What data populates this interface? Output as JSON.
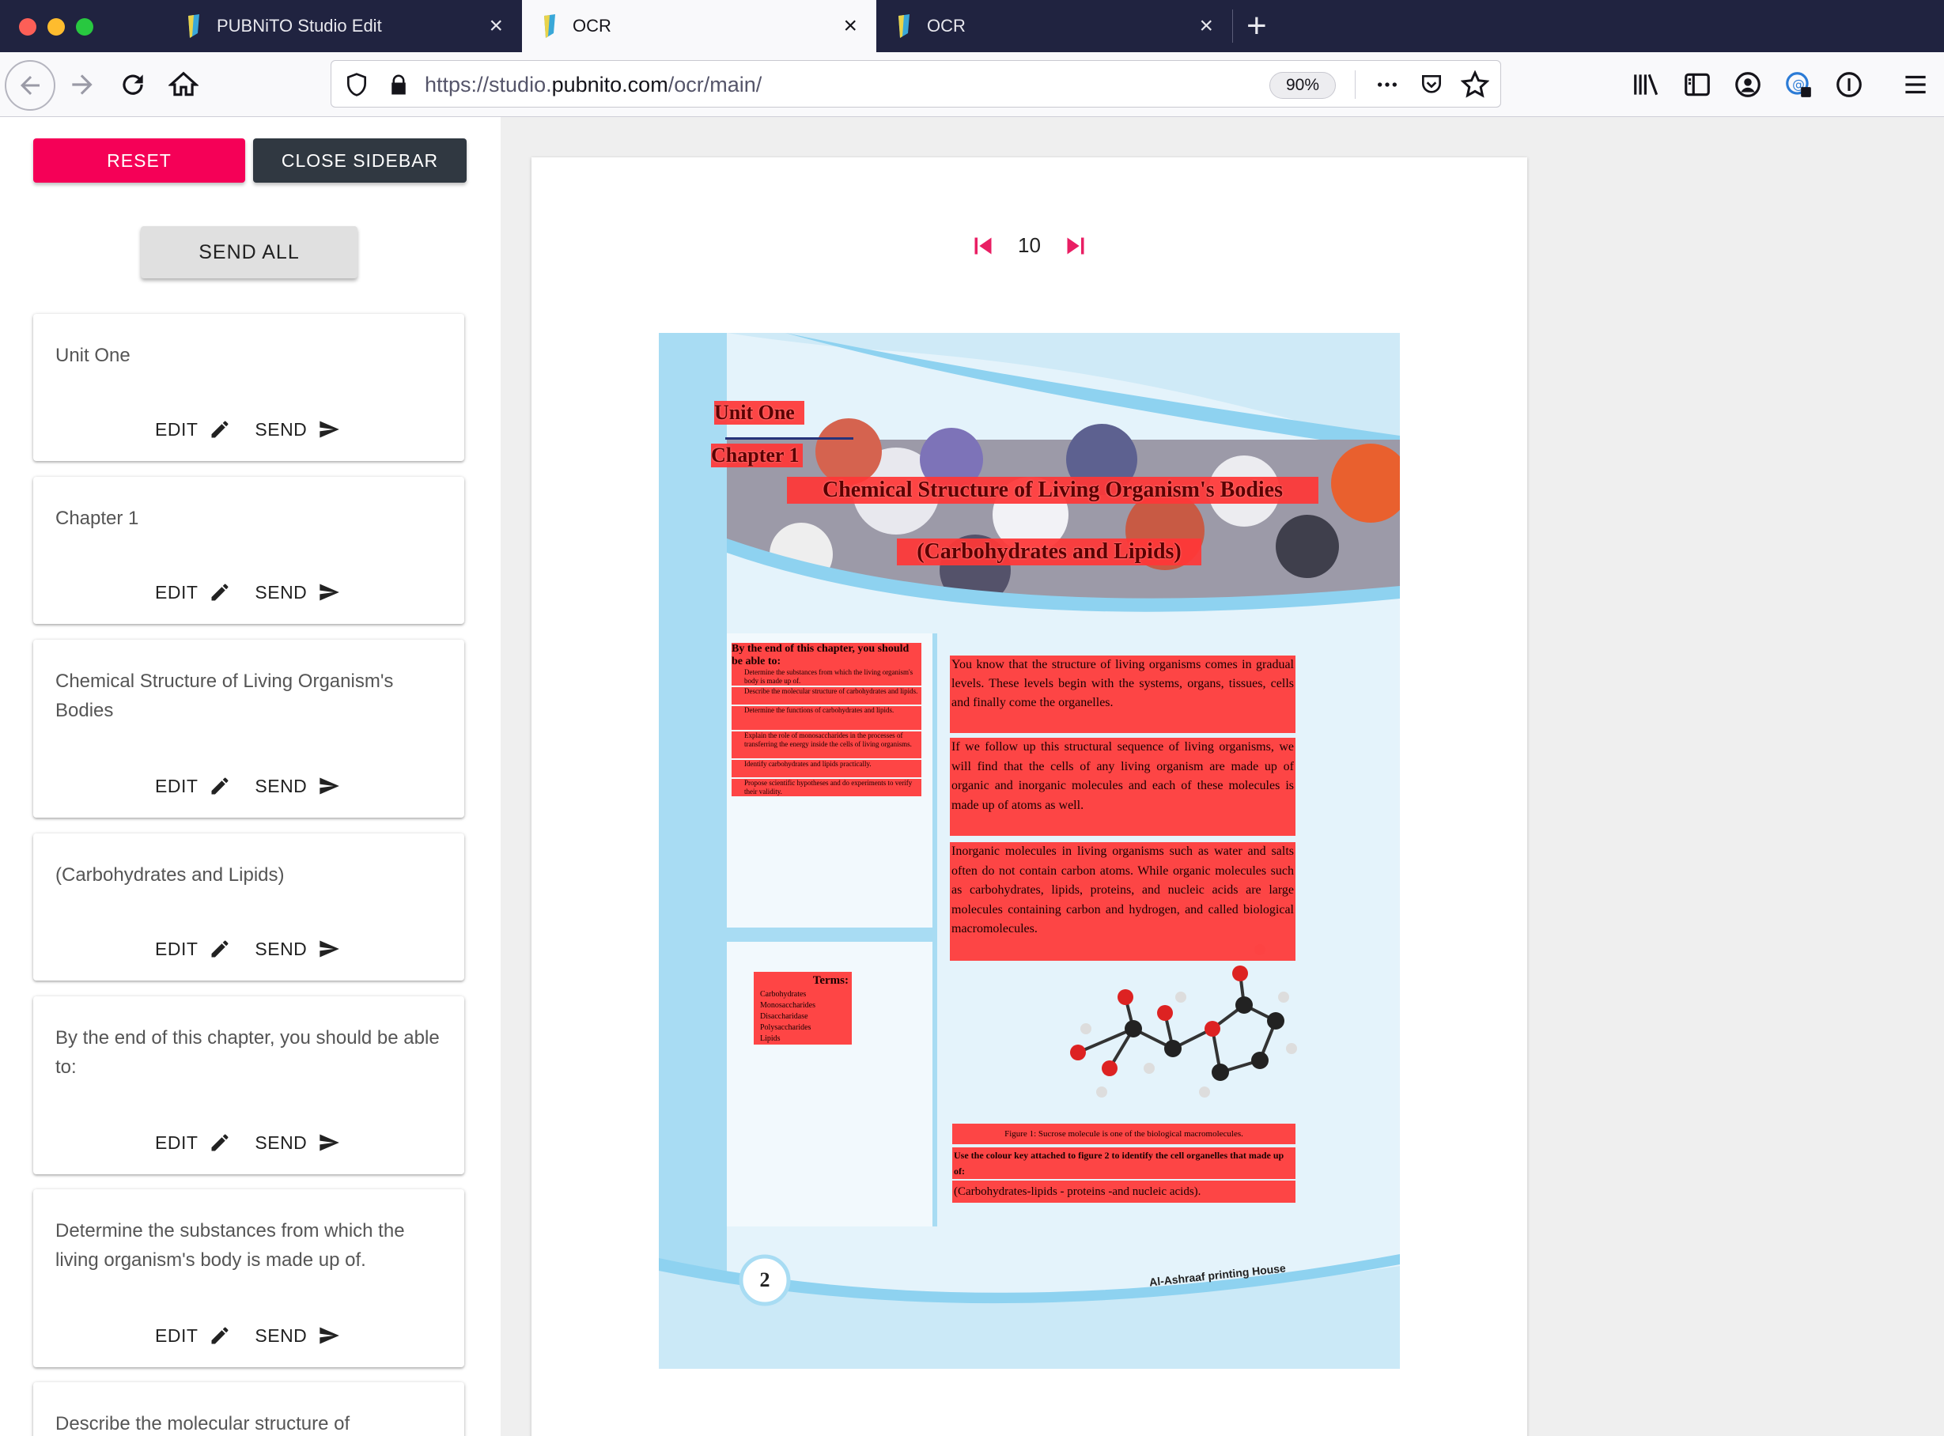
{
  "browser": {
    "tabs": [
      {
        "title": "PUBNiTO Studio Edit",
        "active": false
      },
      {
        "title": "OCR",
        "active": true
      },
      {
        "title": "OCR",
        "active": false
      }
    ],
    "url_prefix": "https://studio.",
    "url_domain": "pubnito.com",
    "url_path": "/ocr/main/",
    "zoom": "90%"
  },
  "sidebar": {
    "reset_label": "RESET",
    "close_label": "CLOSE SIDEBAR",
    "send_all_label": "SEND ALL",
    "edit_label": "EDIT",
    "send_label": "SEND",
    "items": [
      "Unit One",
      "Chapter 1",
      "Chemical Structure of Living Organism's Bodies",
      "(Carbohydrates and Lipids)",
      "By the end of this chapter, you should be able to:",
      "Determine the substances from which the living organism's body is made up of.",
      "Describe the molecular structure of"
    ]
  },
  "viewer": {
    "page_number": "10"
  },
  "document": {
    "unit": "Unit One",
    "chapter": "Chapter 1",
    "title": "Chemical Structure of Living Organism's Bodies",
    "subtitle": "(Carbohydrates and Lipids)",
    "objectives_heading": "By the end of this chapter, you should be able to:",
    "objectives": [
      "Determine the substances from which the living organism's body is made up of.",
      "Describe the molecular structure of carbohydrates and lipids.",
      "Determine the functions of carbohydrates and lipids.",
      "Explain the role of monosaccharides in the processes of transferring the energy inside the cells of living organisms.",
      "Identify carbohydrates and lipids practically.",
      "Propose scientific hypotheses and do experiments to verify their validity."
    ],
    "paragraphs": [
      "You know that the structure of living organisms comes in gradual levels. These levels begin with the systems, organs, tissues, cells and finally come the organelles.",
      "If we follow up this structural sequence of living organisms, we will find that the cells of any living organism are made up of organic and inorganic molecules and each of these molecules is made up of atoms as well.",
      "Inorganic molecules in living organisms such as water and salts often do not contain carbon atoms. While organic molecules such as carbohydrates, lipids, proteins, and nucleic acids are large molecules containing carbon and hydrogen, and called biological macromolecules."
    ],
    "terms_heading": "Terms:",
    "terms": [
      "Carbohydrates",
      "Monosaccharides",
      "Disaccharidase",
      "Polysaccharides",
      "Lipids"
    ],
    "figure_caption": "Figure 1: Sucrose molecule is one of the biological macromolecules.",
    "task": "Use the colour key attached to figure 2 to identify the cell organelles that made up of:",
    "task_answer": "(Carbohydrates-lipids - proteins -and nucleic acids).",
    "page_num": "2",
    "publisher": "Al-Ashraaf printing House"
  },
  "colors": {
    "accent_pink": "#f50057",
    "dark_button": "#303841",
    "ocr_highlight": "#ff3737",
    "tabbar": "#202340"
  }
}
